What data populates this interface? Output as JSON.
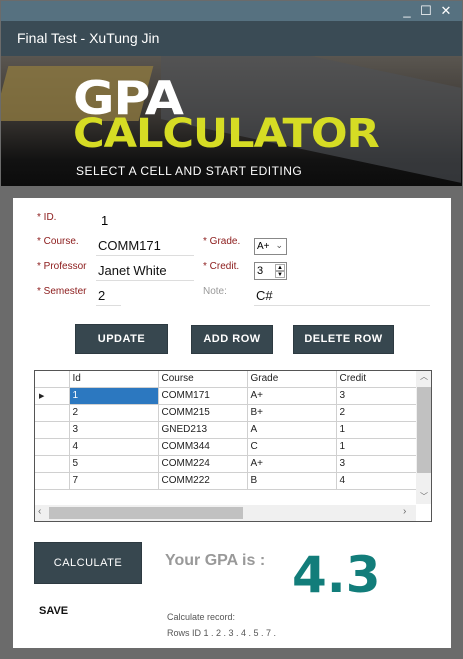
{
  "window": {
    "title": "Final Test - XuTung Jin",
    "minimize": "_",
    "maximize": "☐",
    "close": "✕"
  },
  "banner": {
    "line1": "GPA",
    "line2": "CALCULATOR",
    "subtitle": "SELECT A CELL AND START EDITING",
    "accent": "#d6dc24"
  },
  "form": {
    "id_label": "* ID.",
    "id_value": "1",
    "course_label": "* Course.",
    "course_value": "COMM171",
    "professor_label": "* Professor",
    "professor_value": "Janet White",
    "semester_label": "* Semester",
    "semester_value": "2",
    "grade_label": "* Grade.",
    "grade_value": "A+",
    "credit_label": "* Credit.",
    "credit_value": "3",
    "note_label": "Note:",
    "note_value": "C#"
  },
  "buttons": {
    "update": "UPDATE",
    "add_row": "ADD ROW",
    "delete_row": "DELETE ROW",
    "calculate": "CALCULATE",
    "save": "SAVE"
  },
  "table": {
    "columns": [
      "Id",
      "Course",
      "Grade",
      "Credit"
    ],
    "rows": [
      [
        "1",
        "COMM171",
        "A+",
        "3"
      ],
      [
        "2",
        "COMM215",
        "B+",
        "2"
      ],
      [
        "3",
        "GNED213",
        "A",
        "1"
      ],
      [
        "4",
        "COMM344",
        "C",
        "1"
      ],
      [
        "5",
        "COMM224",
        "A+",
        "3"
      ],
      [
        "7",
        "COMM222",
        "B",
        "4"
      ]
    ]
  },
  "result": {
    "label": "Your GPA is :",
    "value": "4.3",
    "color": "#127d7a",
    "record_label": "Calculate record:",
    "record_rows": "Rows ID 1 . 2 . 3 . 4 . 5 . 7 ."
  }
}
